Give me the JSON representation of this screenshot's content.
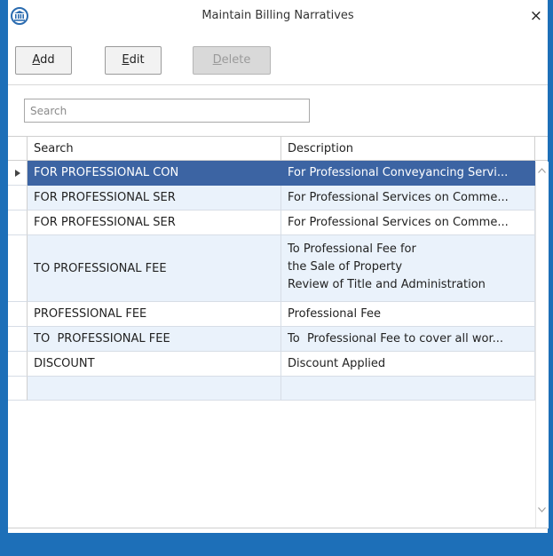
{
  "window": {
    "title": "Maintain Billing Narratives",
    "close_symbol": "×"
  },
  "toolbar": {
    "add": {
      "mnemonic": "A",
      "rest": "dd"
    },
    "edit": {
      "mnemonic": "E",
      "rest": "dit"
    },
    "delete": {
      "mnemonic": "D",
      "rest": "elete",
      "disabled": true
    }
  },
  "search": {
    "placeholder": "Search"
  },
  "grid": {
    "columns": [
      "Search",
      "Description"
    ],
    "rows": [
      {
        "search": "FOR PROFESSIONAL CON",
        "description": [
          "For Professional Conveyancing Servi..."
        ],
        "selected": true
      },
      {
        "search": "FOR PROFESSIONAL SER",
        "description": [
          "For Professional Services on Comme..."
        ]
      },
      {
        "search": "FOR PROFESSIONAL SER",
        "description": [
          "For Professional Services on Comme..."
        ]
      },
      {
        "search": "TO PROFESSIONAL FEE",
        "description": [
          "To Professional Fee for",
          "the Sale of Property",
          "Review of Title and Administration"
        ]
      },
      {
        "search": "PROFESSIONAL FEE",
        "description": [
          "Professional Fee"
        ]
      },
      {
        "search": "TO  PROFESSIONAL FEE",
        "description": [
          "To  Professional Fee to cover all wor..."
        ]
      },
      {
        "search": "DISCOUNT",
        "description": [
          "Discount Applied"
        ]
      },
      {
        "search": "",
        "description": [
          ""
        ]
      }
    ]
  },
  "colors": {
    "accent": "#1d6fb8",
    "selected_row": "#3c64a3",
    "alt_row": "#eaf2fb"
  },
  "icons": {
    "app": "institution-icon",
    "row_pointer": "triangle-right-icon",
    "scroll_up": "chevron-up-icon",
    "scroll_down": "chevron-down-icon"
  }
}
